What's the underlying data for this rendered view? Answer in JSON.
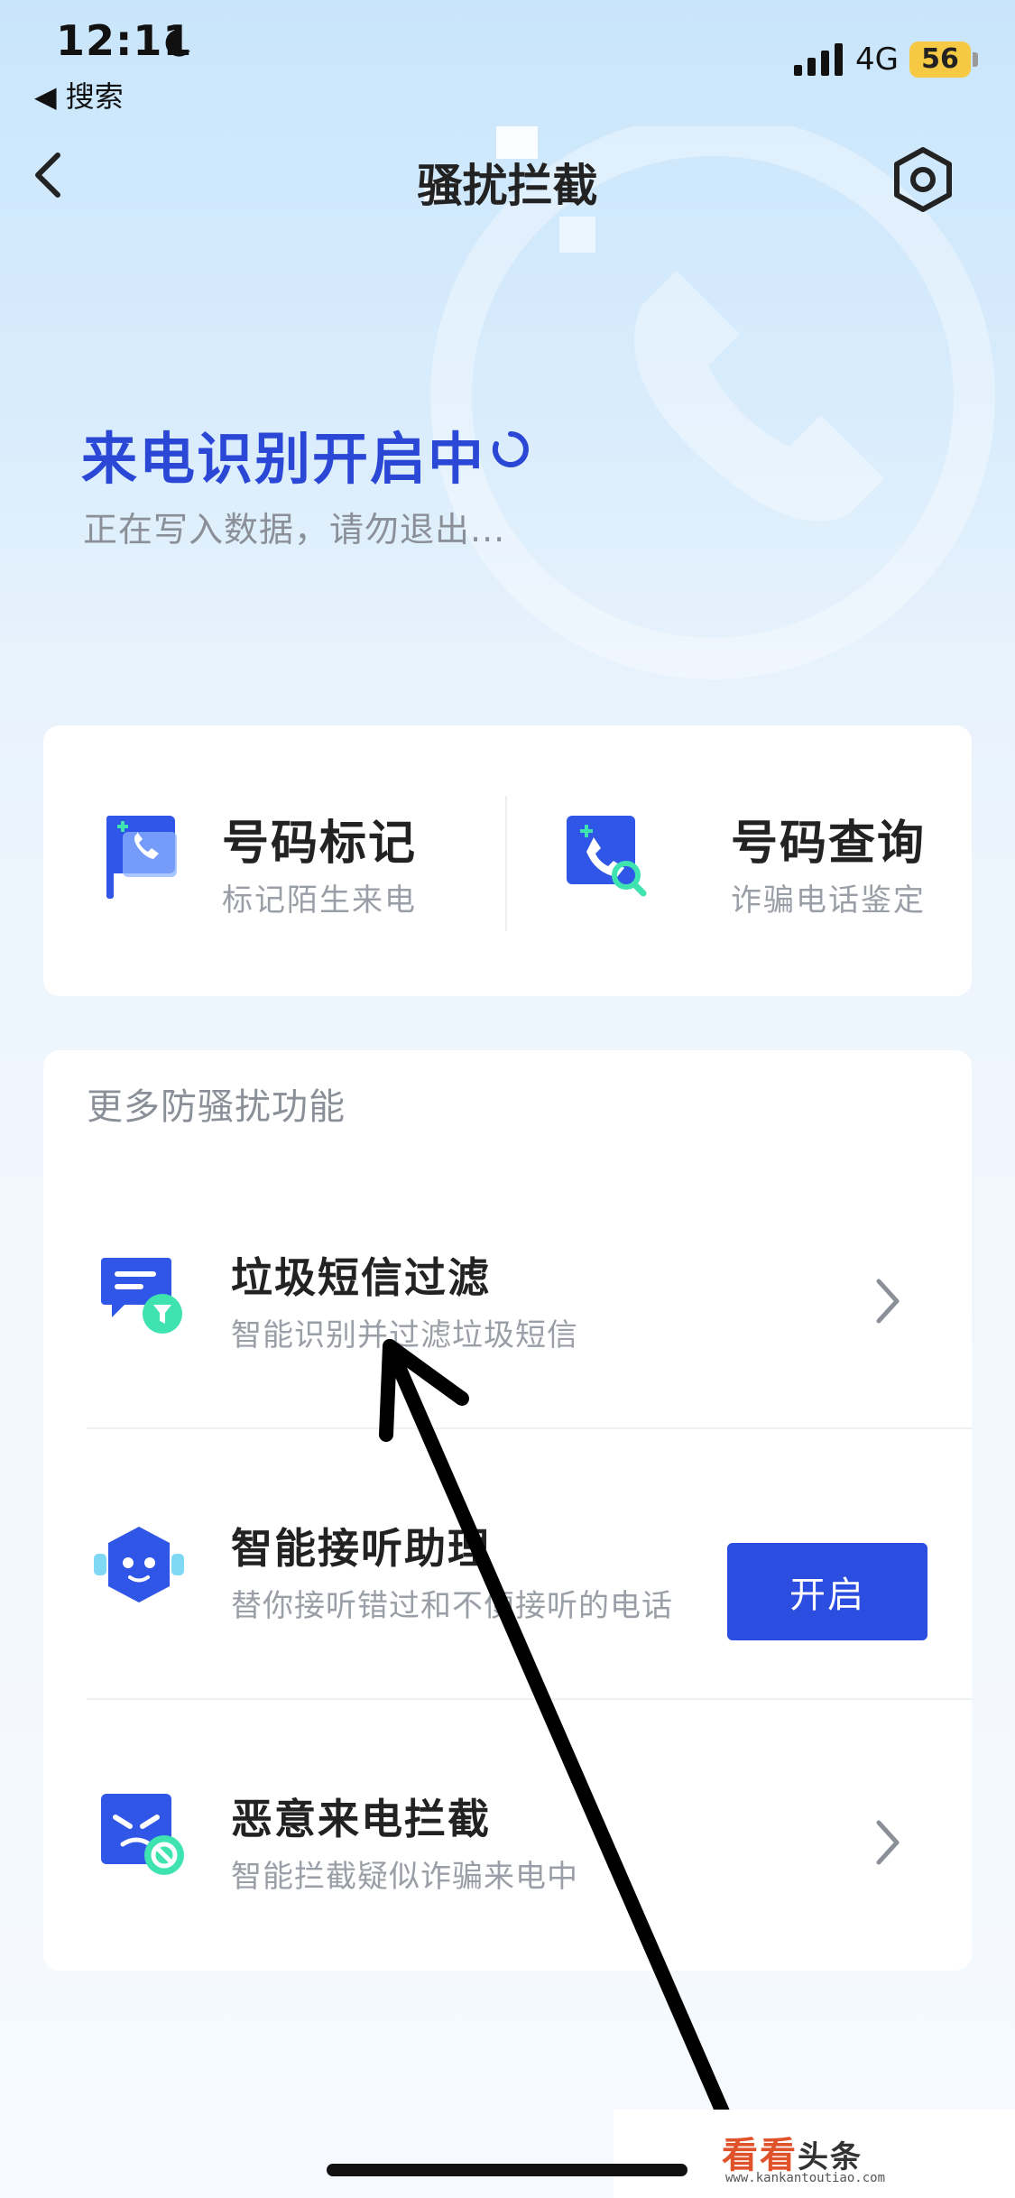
{
  "status_bar": {
    "time": "12:11",
    "back_app": "◀ 搜索",
    "network": "4G",
    "battery": "56"
  },
  "nav": {
    "title": "骚扰拦截"
  },
  "hero": {
    "title": "来电识别开启中",
    "subtitle": "正在写入数据，请勿退出..."
  },
  "tools": [
    {
      "title": "号码标记",
      "subtitle": "标记陌生来电"
    },
    {
      "title": "号码查询",
      "subtitle": "诈骗电话鉴定"
    }
  ],
  "more": {
    "section_title": "更多防骚扰功能",
    "items": [
      {
        "title": "垃圾短信过滤",
        "subtitle": "智能识别并过滤垃圾短信"
      },
      {
        "title": "智能接听助理",
        "subtitle": "替你接听错过和不便接听的电话",
        "button": "开启"
      },
      {
        "title": "恶意来电拦截",
        "subtitle": "智能拦截疑似诈骗来电中"
      }
    ]
  },
  "watermark": {
    "brand": "看看",
    "brand2": "头条",
    "url": "www.kankantoutiao.com"
  },
  "colors": {
    "accent": "#2c4ee0",
    "hero_title": "#2a47d6",
    "muted": "#9a9ea6"
  }
}
